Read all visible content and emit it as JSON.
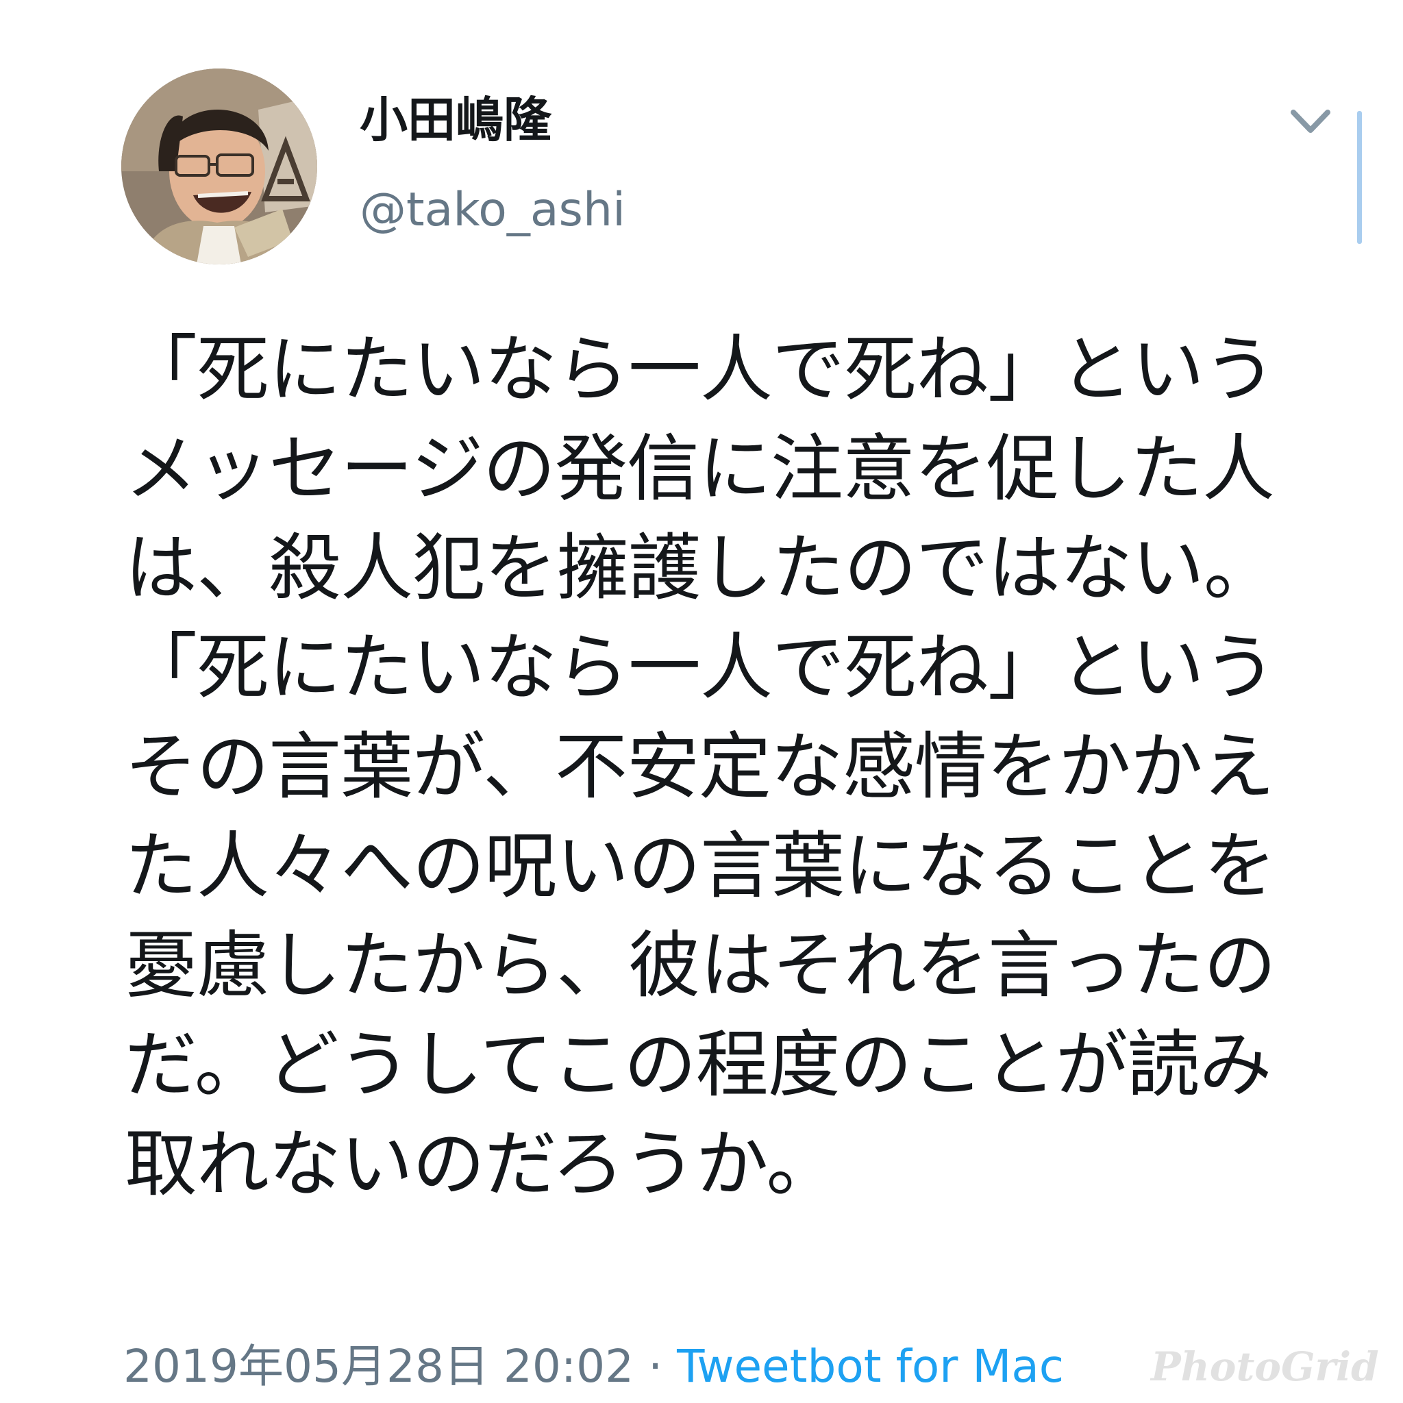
{
  "author": {
    "display_name": "小田嶋隆",
    "handle": "@tako_ashi"
  },
  "tweet": {
    "text": "「死にたいなら一人で死ね」というメッセージの発信に注意を促した人は、殺人犯を擁護したのではない。\n「死にたいなら一人で死ね」というその言葉が、不安定な感情をかかえた人々への呪いの言葉になることを憂慮したから、彼はそれを言ったのだ。どうしてこの程度のことが読み取れないのだろうか。"
  },
  "meta": {
    "timestamp": "2019年05月28日 20:02",
    "separator": " · ",
    "source": "Tweetbot for Mac"
  },
  "watermark": "PhotoGrid",
  "icons": {
    "caret": "chevron-down-icon",
    "avatar": "avatar-photo"
  },
  "colors": {
    "text": "#14171a",
    "secondary": "#657786",
    "link": "#1da1f2"
  }
}
